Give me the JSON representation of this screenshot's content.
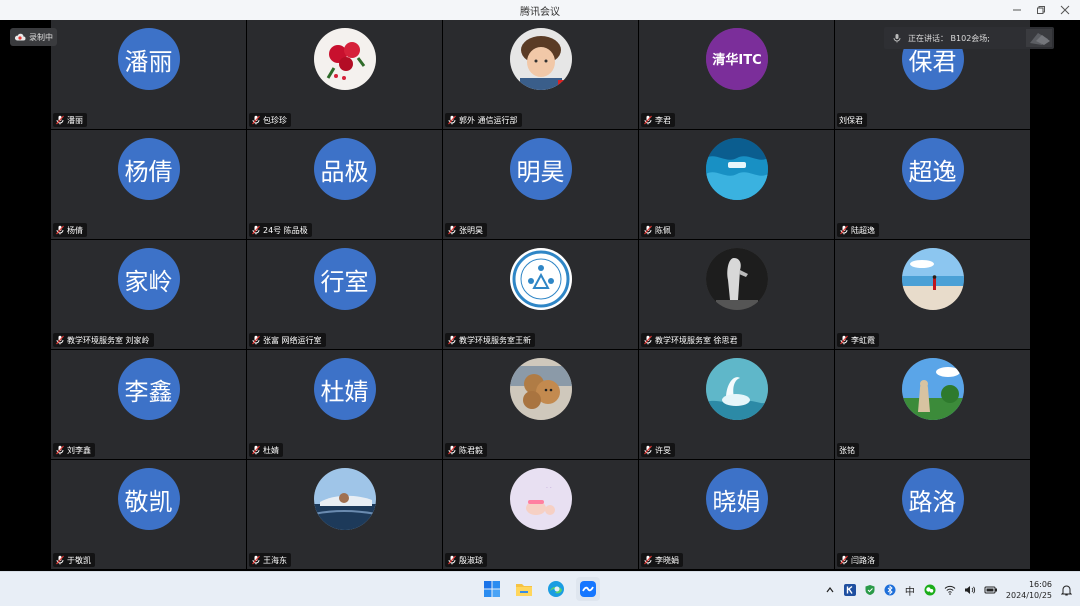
{
  "window": {
    "title": "腾讯会议"
  },
  "recording": {
    "label": "录制中"
  },
  "speaking": {
    "label": "正在讲话： B102会场;"
  },
  "tiles": [
    {
      "name": "潘丽",
      "avatar_text": "潘丽",
      "avatar_type": "text",
      "mic": true
    },
    {
      "name": "包珍珍",
      "avatar_text": "",
      "avatar_type": "roses",
      "mic": true
    },
    {
      "name": "郭外 通信运行部",
      "avatar_text": "",
      "avatar_type": "baby",
      "mic": true
    },
    {
      "name": "李君",
      "avatar_text": "清华ITC",
      "avatar_type": "itc",
      "mic": true
    },
    {
      "name": "刘保君",
      "avatar_text": "保君",
      "avatar_type": "text",
      "mic": false
    },
    {
      "name": "杨倩",
      "avatar_text": "杨倩",
      "avatar_type": "text",
      "mic": true
    },
    {
      "name": "24号 陈品极",
      "avatar_text": "品极",
      "avatar_type": "text",
      "mic": true
    },
    {
      "name": "张明昊",
      "avatar_text": "明昊",
      "avatar_type": "text",
      "mic": true
    },
    {
      "name": "陈佩",
      "avatar_text": "",
      "avatar_type": "ocean",
      "mic": true
    },
    {
      "name": "陆超逸",
      "avatar_text": "超逸",
      "avatar_type": "text",
      "mic": true
    },
    {
      "name": "教学环境服务室 刘家岭",
      "avatar_text": "家岭",
      "avatar_type": "text",
      "mic": true
    },
    {
      "name": "张富 网络运行室",
      "avatar_text": "行室",
      "avatar_type": "text",
      "mic": true
    },
    {
      "name": "教学环境服务室王新",
      "avatar_text": "",
      "avatar_type": "logo",
      "mic": true
    },
    {
      "name": "教学环境服务室 徐思君",
      "avatar_text": "",
      "avatar_type": "statue",
      "mic": true
    },
    {
      "name": "李虹霞",
      "avatar_text": "",
      "avatar_type": "beach",
      "mic": true
    },
    {
      "name": "刘李鑫",
      "avatar_text": "李鑫",
      "avatar_type": "text",
      "mic": true
    },
    {
      "name": "杜婧",
      "avatar_text": "杜婧",
      "avatar_type": "text",
      "mic": true
    },
    {
      "name": "陈君毅",
      "avatar_text": "",
      "avatar_type": "bear",
      "mic": true
    },
    {
      "name": "许旻",
      "avatar_text": "",
      "avatar_type": "swan",
      "mic": true
    },
    {
      "name": "张铭",
      "avatar_text": "",
      "avatar_type": "park",
      "mic": false
    },
    {
      "name": "于敬凯",
      "avatar_text": "敬凯",
      "avatar_type": "text",
      "mic": true
    },
    {
      "name": "王海东",
      "avatar_text": "",
      "avatar_type": "plane",
      "mic": true
    },
    {
      "name": "殷淑琼",
      "avatar_text": "",
      "avatar_type": "babyhand",
      "mic": true
    },
    {
      "name": "李晓娟",
      "avatar_text": "晓娟",
      "avatar_type": "text",
      "mic": true
    },
    {
      "name": "闫路洛",
      "avatar_text": "路洛",
      "avatar_type": "text",
      "mic": true
    }
  ],
  "taskbar": {
    "apps": [
      "windows-start-icon",
      "file-explorer-icon",
      "edge-browser-icon",
      "tencent-meeting-icon"
    ],
    "tray": {
      "ime": "中",
      "time": "16:06",
      "date": "2024/10/25"
    }
  },
  "colors": {
    "avatar_blue": "#3d72c8",
    "tile_bg": "#2a2b2e",
    "itc_purple": "#7b2e9a"
  }
}
